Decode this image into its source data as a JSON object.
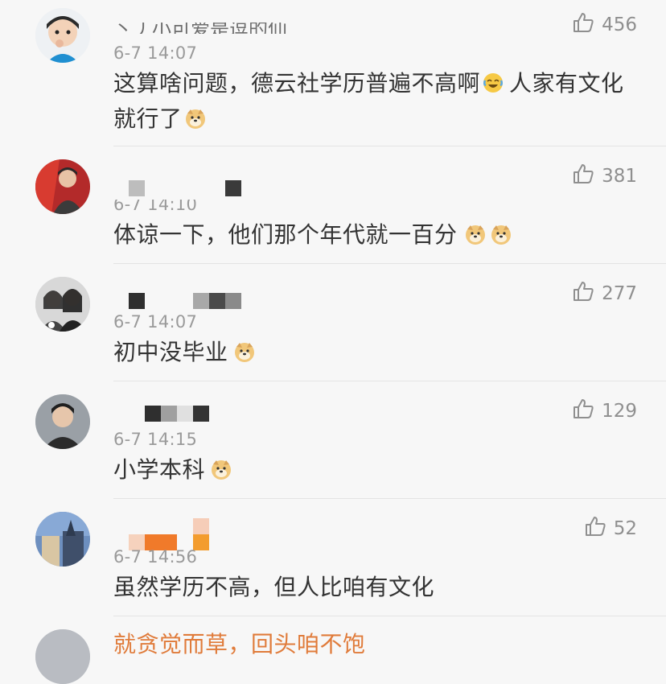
{
  "comments": [
    {
      "username": "丶丿小可爱是逗的仙",
      "time": "6-7 14:07",
      "text_a": "这算啥问题，德云社学历普遍不高啊",
      "text_b": "人家有文化就行了",
      "likes": "456"
    },
    {
      "username": "",
      "time": "6-7 14:10",
      "text_a": "体谅一下，他们那个年代就一百分",
      "likes": "381"
    },
    {
      "username": "",
      "time": "6-7 14:07",
      "text_a": "初中没毕业",
      "likes": "277"
    },
    {
      "username": "",
      "time": "6-7 14:15",
      "text_a": "小学本科",
      "likes": "129"
    },
    {
      "username": "",
      "time": "6-7 14:56",
      "text_a": "虽然学历不高，但人比咱有文化",
      "likes": "52"
    }
  ],
  "partial_comment": {
    "text": "就贪觉而草，回头咱不饱"
  },
  "icons": {
    "like": "thumb-up-icon",
    "doge": "doge-emoji-icon",
    "laugh": "laugh-cry-emoji-icon"
  },
  "colors": {
    "background": "#f7f7f7",
    "text": "#333333",
    "meta": "#9a9a9a",
    "accent": "#e07b3a"
  }
}
